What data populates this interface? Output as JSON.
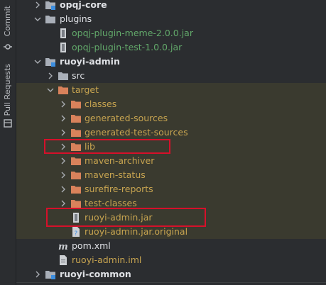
{
  "sidebar": {
    "commit_label": "Commit",
    "pull_requests_label": "Pull Requests"
  },
  "tree": {
    "opqj_core": "opqj-core",
    "plugins": "plugins",
    "plugin_meme": "opqj-plugin-meme-2.0.0.jar",
    "plugin_test": "opqj-plugin-test-1.0.0.jar",
    "ruoyi_admin": "ruoyi-admin",
    "src": "src",
    "target": "target",
    "classes": "classes",
    "generated_sources": "generated-sources",
    "generated_test_sources": "generated-test-sources",
    "lib": "lib",
    "maven_archiver": "maven-archiver",
    "maven_status": "maven-status",
    "surefire_reports": "surefire-reports",
    "test_classes": "test-classes",
    "ruoyi_admin_jar": "ruoyi-admin.jar",
    "ruoyi_admin_jar_original": "ruoyi-admin.jar.original",
    "pom": "pom.xml",
    "ruoyi_admin_iml": "ruoyi-admin.iml",
    "ruoyi_common": "ruoyi-common"
  },
  "colors": {
    "background": "#2b2d30",
    "excluded_folder_text": "#c7a450",
    "jar_text": "#62a86a",
    "highlight_box": "#d6102a",
    "target_highlight": "#3a3a2f"
  }
}
